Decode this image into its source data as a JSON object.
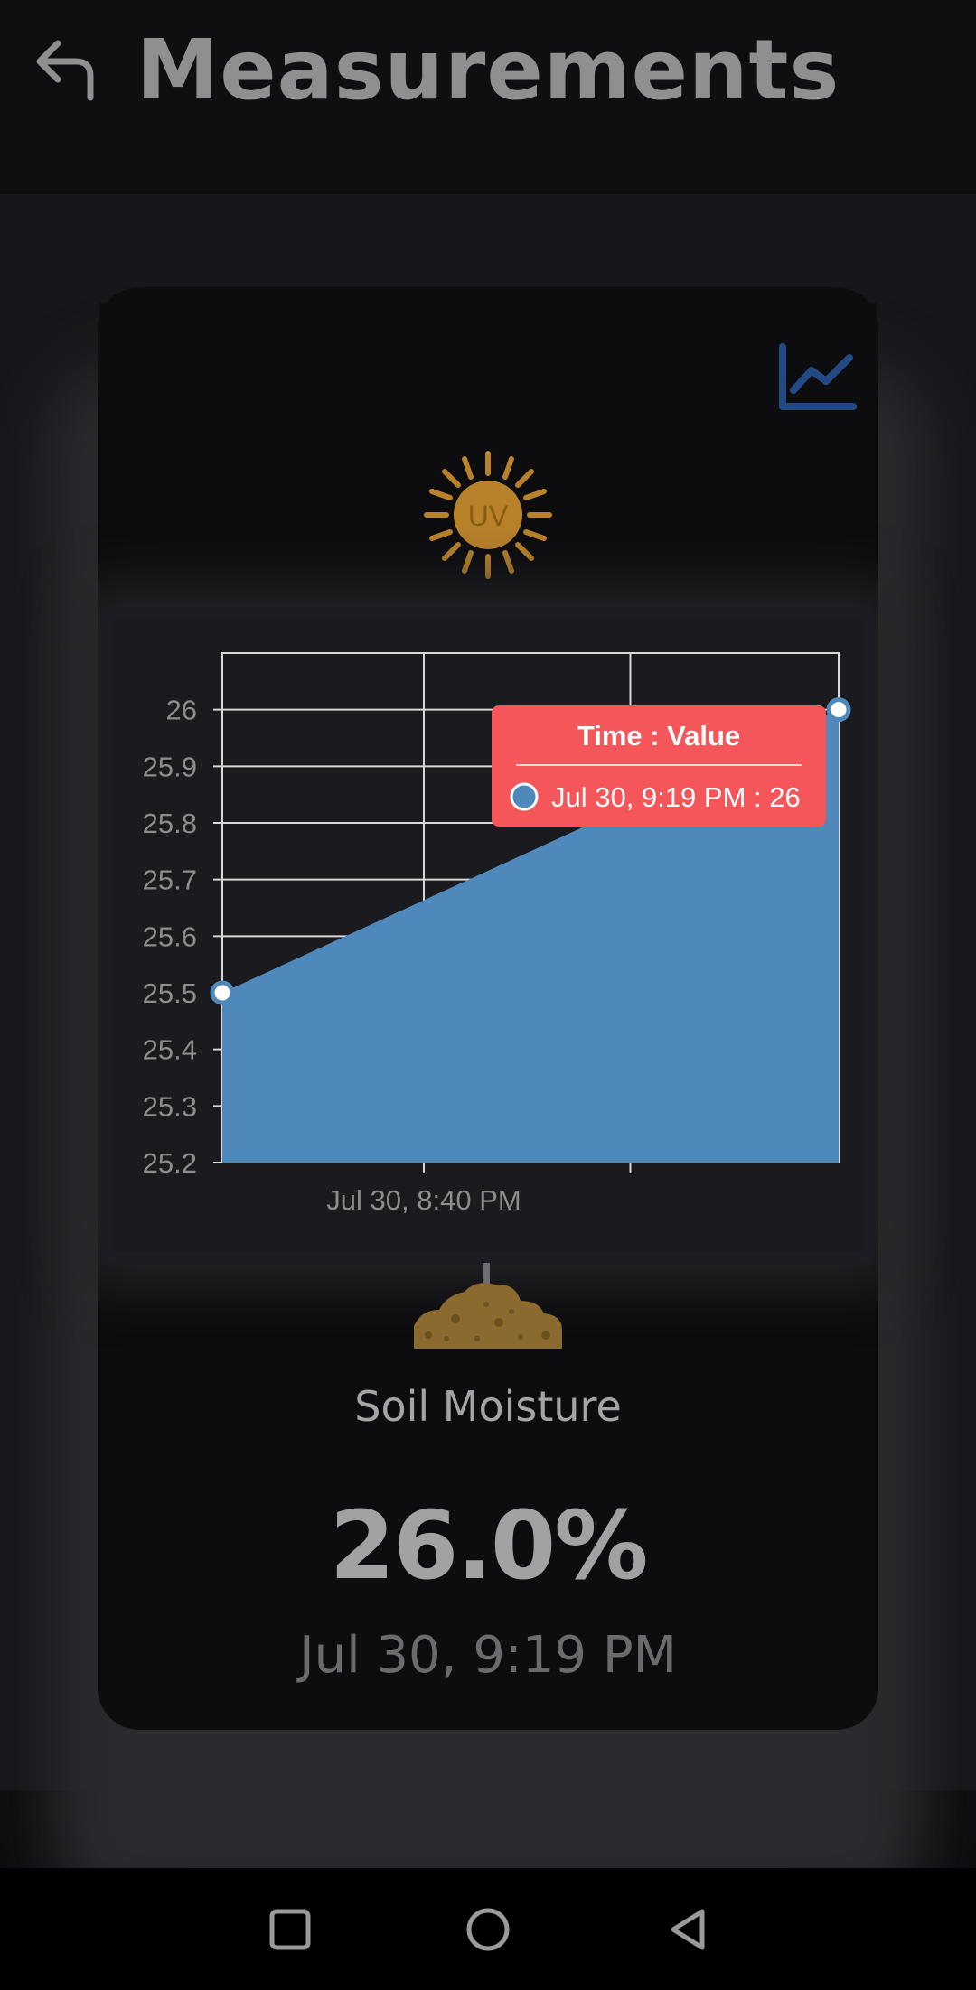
{
  "header": {
    "title": "Measurements",
    "back_icon": "back-arrow-icon"
  },
  "card": {
    "trend_icon": "line-chart-icon",
    "uv_icon_label": "UV",
    "soil": {
      "label": "Soil Moisture",
      "value": "26.0%",
      "timestamp": "Jul 30, 9:19 PM"
    }
  },
  "chart_data": {
    "type": "area",
    "x": [
      "Jul 30, 8:40 PM",
      "Jul 30, 9:19 PM"
    ],
    "y": [
      25.5,
      26
    ],
    "ylim": [
      25.2,
      26.1
    ],
    "yticks": [
      "26",
      "25.9",
      "25.8",
      "25.7",
      "25.6",
      "25.5",
      "25.4",
      "25.3",
      "25.2"
    ],
    "xtick_labels": [
      "Jul 30, 8:40 PM"
    ],
    "grid": true,
    "series_color": "#4f89bb",
    "tooltip": {
      "title": "Time : Value",
      "entry": "Jul 30, 9:19 PM : 26",
      "background": "#f4565a"
    }
  },
  "nav": {
    "recent_icon": "recents-square-icon",
    "home_icon": "home-circle-icon",
    "back_icon": "back-triangle-icon"
  }
}
